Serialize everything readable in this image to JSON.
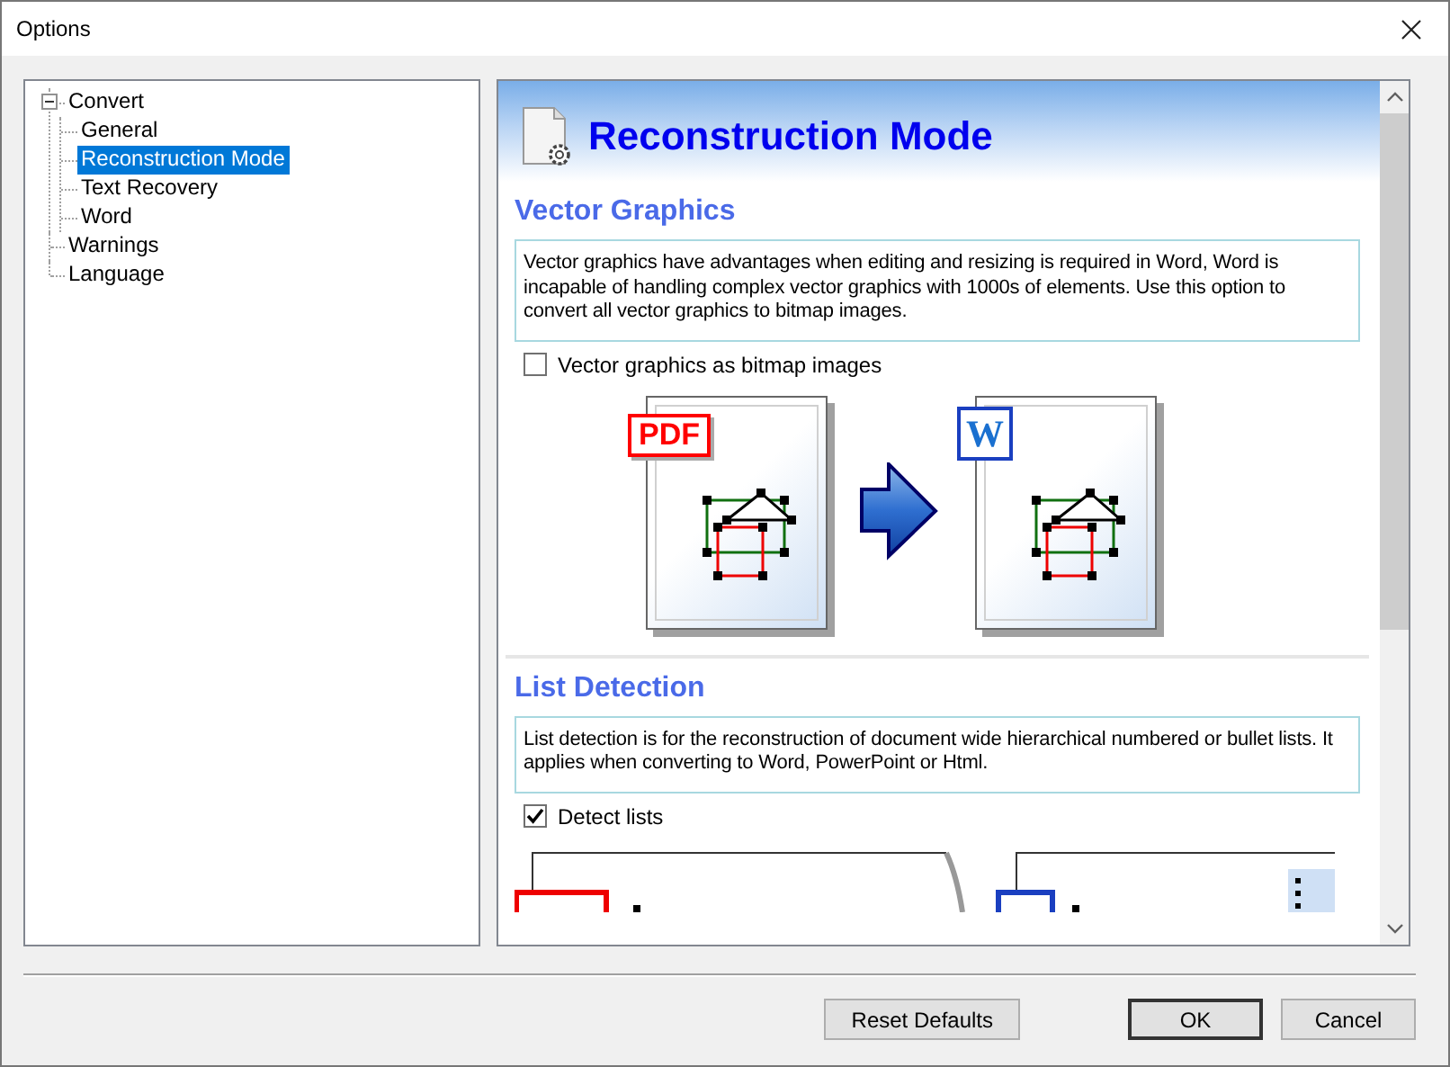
{
  "window": {
    "title": "Options"
  },
  "tree": [
    {
      "label": "Convert",
      "expanded": true,
      "selected": false,
      "children": [
        {
          "label": "General",
          "selected": false
        },
        {
          "label": "Reconstruction Mode",
          "selected": true
        },
        {
          "label": "Text Recovery",
          "selected": false
        },
        {
          "label": "Word",
          "selected": false
        }
      ]
    },
    {
      "label": "Warnings",
      "selected": false
    },
    {
      "label": "Language",
      "selected": false
    }
  ],
  "page": {
    "title": "Reconstruction Mode",
    "sections": [
      {
        "heading": "Vector Graphics",
        "description": "Vector graphics have advantages when editing and resizing is required in Word, Word is incapable of handling complex vector graphics with 1000s of elements. Use this option to convert all vector graphics to bitmap images.",
        "option": {
          "label": "Vector graphics as bitmap images",
          "checked": false
        },
        "illustration": {
          "kind": "vector",
          "source_badge": "PDF",
          "target_badge": "W"
        }
      },
      {
        "heading": "List Detection",
        "description": "List detection is for the reconstruction of document wide hierarchical numbered or bullet lists. It applies when converting to Word, PowerPoint or Html.",
        "option": {
          "label": "Detect lists",
          "checked": true
        },
        "illustration": {
          "kind": "list"
        }
      }
    ]
  },
  "buttons": [
    {
      "label": "Reset Defaults",
      "default": false
    },
    {
      "label": "OK",
      "default": true
    },
    {
      "label": "Cancel",
      "default": false
    }
  ]
}
